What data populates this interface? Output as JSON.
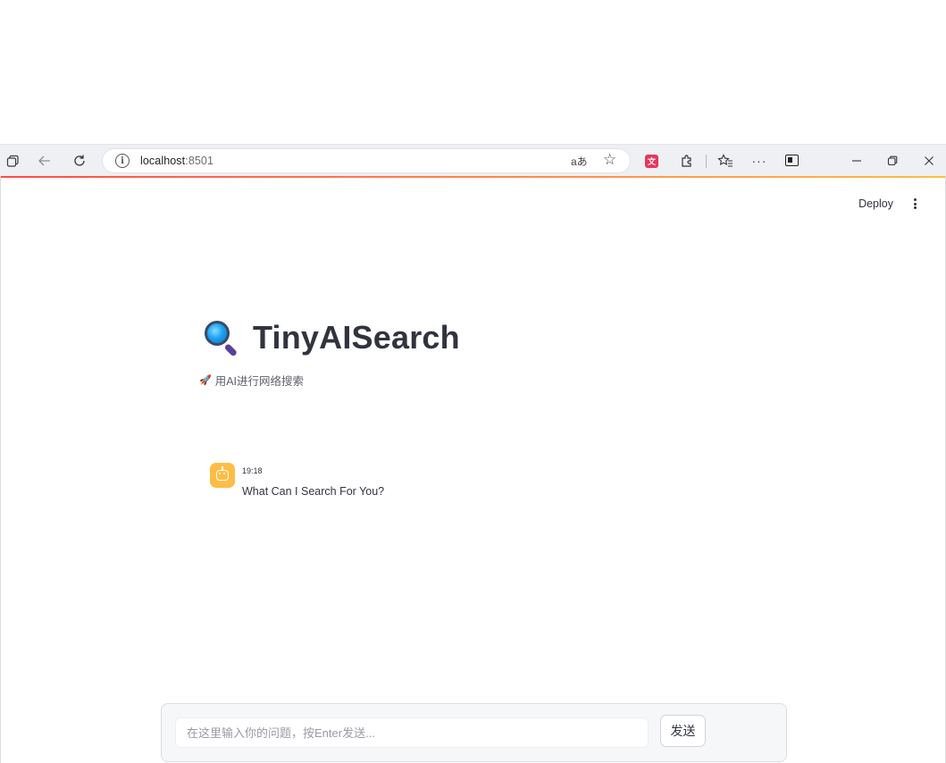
{
  "browser": {
    "url_host": "localhost",
    "url_port": ":8501",
    "read_aloud_label": "aあ",
    "icons": {
      "tabs": "tab-actions-icon",
      "back": "back-arrow-icon",
      "refresh": "refresh-icon",
      "info": "site-info-icon",
      "favorite": "star-icon",
      "translate_ext": "translate-extension-icon",
      "extensions": "puzzle-icon",
      "favorites": "favorites-icon",
      "more": "more-icon",
      "sidebar": "sidebar-toggle-icon",
      "minimize": "minimize-icon",
      "restore": "restore-icon",
      "close": "close-icon"
    }
  },
  "header": {
    "deploy_label": "Deploy"
  },
  "app": {
    "title": "TinyAISearch",
    "subtitle": "用AI进行网络搜索",
    "title_icon": "magnifier-icon",
    "subtitle_icon": "rocket-icon"
  },
  "chat": {
    "messages": [
      {
        "role": "assistant",
        "time": "19:18",
        "text": "What Can I Search For You?"
      }
    ],
    "input_placeholder": "在这里输入你的问题，按Enter发送...",
    "input_value": "",
    "send_label": "发送"
  },
  "colors": {
    "accent_start": "#ff4b4b",
    "accent_end": "#ffbd45",
    "avatar_bg": "#ffbd45",
    "text": "#31333f"
  }
}
